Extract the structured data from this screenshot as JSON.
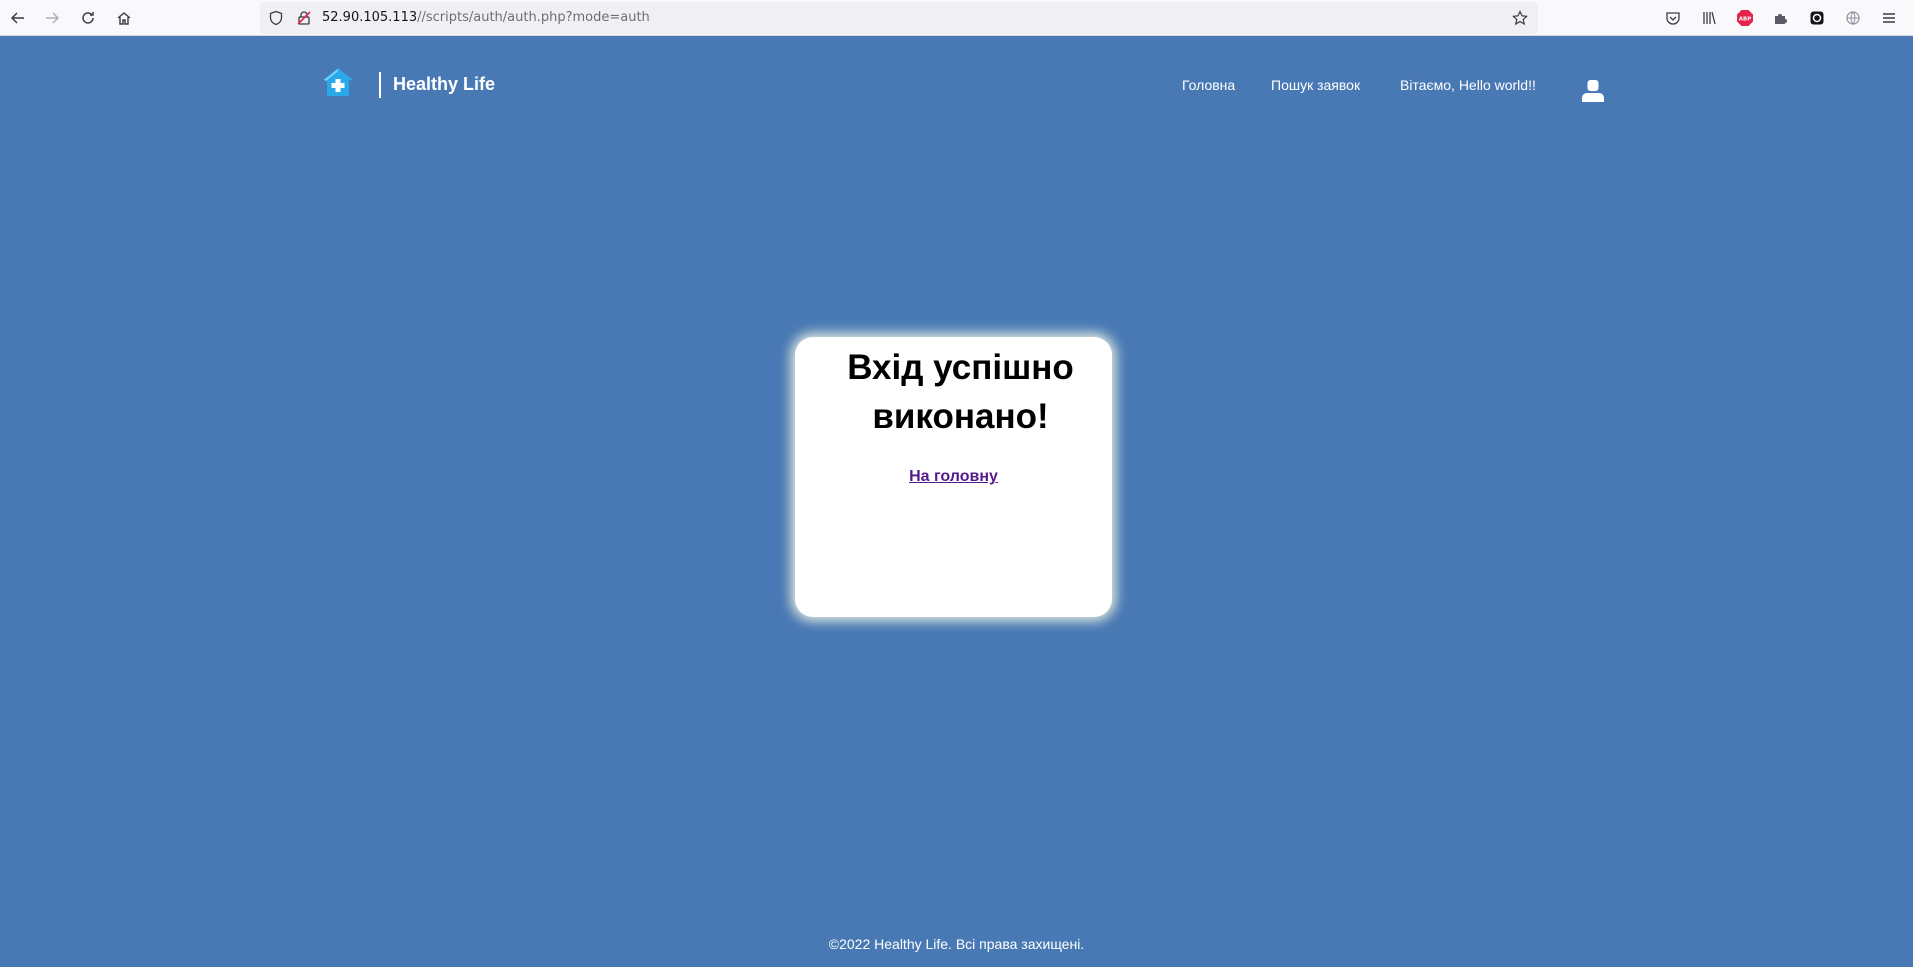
{
  "browser": {
    "url_host": "52.90.105.113",
    "url_path": "//scripts/auth/auth.php?mode=auth",
    "icons": [
      "back-arrow-icon",
      "forward-arrow-icon",
      "reload-icon",
      "home-icon",
      "shield-icon",
      "insecure-lock-icon",
      "bookmark-star-icon",
      "pocket-icon",
      "library-icon",
      "adblock-icon",
      "extension-icon",
      "sync-icon",
      "globe-icon",
      "menu-icon"
    ],
    "adblock_label": "ABP"
  },
  "header": {
    "brand": "Healthy Life",
    "nav": [
      "Головна",
      "Пошук заявок",
      "Вітаємо, Hello world!!"
    ],
    "accent_color": "#4879b4"
  },
  "card": {
    "title": "Вхід успішно виконано!",
    "link": "На головну"
  },
  "footer": {
    "text": "©2022 Healthy Life. Всі права захищені."
  }
}
